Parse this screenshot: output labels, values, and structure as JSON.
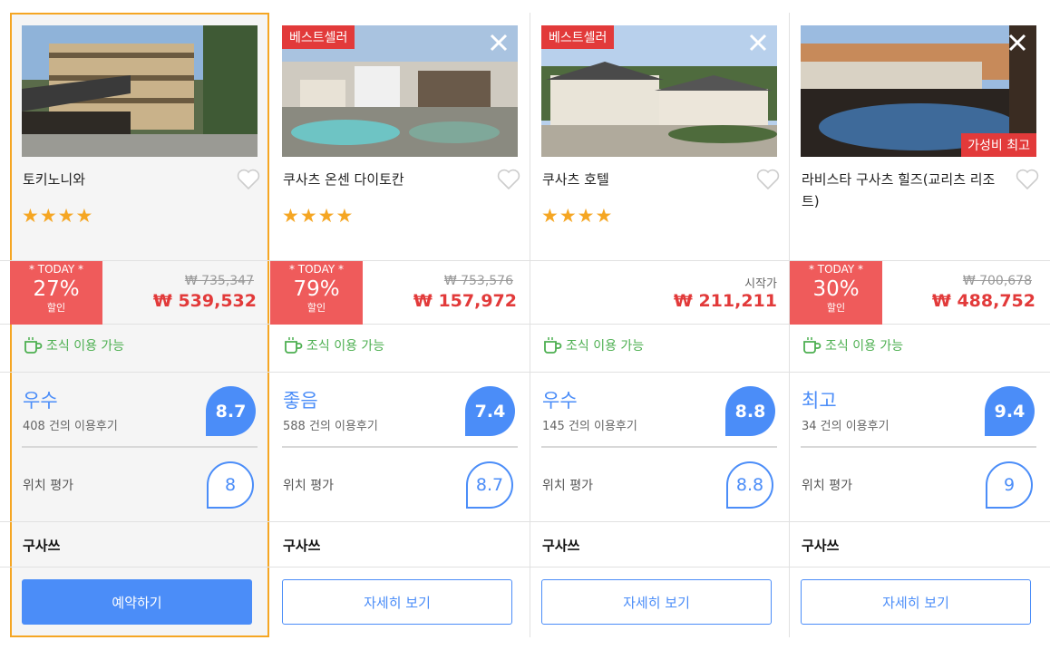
{
  "hotels": [
    {
      "name": "토키노니와",
      "best_badge": "",
      "value_badge": "",
      "stars": "★★★★",
      "today_label": "* TODAY *",
      "discount": "27%",
      "discount_label": "할인",
      "old_price": "₩ 735,347",
      "price": "₩ 539,532",
      "breakfast": "조식 이용 가능",
      "rating_word": "우수",
      "reviews": "408 건의 이용후기",
      "score": "8.7",
      "location_label": "위치 평가",
      "location_score": "8",
      "area": "구사쓰",
      "button": "예약하기"
    },
    {
      "name": "쿠사츠 온센 다이토칸",
      "best_badge": "베스트셀러",
      "value_badge": "",
      "stars": "★★★★",
      "today_label": "* TODAY *",
      "discount": "79%",
      "discount_label": "할인",
      "old_price": "₩ 753,576",
      "price": "₩ 157,972",
      "breakfast": "조식 이용 가능",
      "rating_word": "좋음",
      "reviews": "588 건의 이용후기",
      "score": "7.4",
      "location_label": "위치 평가",
      "location_score": "8.7",
      "area": "구사쓰",
      "button": "자세히 보기"
    },
    {
      "name": "쿠사츠 호텔",
      "best_badge": "베스트셀러",
      "value_badge": "",
      "stars": "★★★★",
      "from_label": "시작가",
      "price": "₩ 211,211",
      "breakfast": "조식 이용 가능",
      "rating_word": "우수",
      "reviews": "145 건의 이용후기",
      "score": "8.8",
      "location_label": "위치 평가",
      "location_score": "8.8",
      "area": "구사쓰",
      "button": "자세히 보기"
    },
    {
      "name": "라비스타 구사츠 힐즈(교리츠 리조트)",
      "best_badge": "",
      "value_badge": "가성비 최고",
      "stars": "",
      "today_label": "* TODAY *",
      "discount": "30%",
      "discount_label": "할인",
      "old_price": "₩ 700,678",
      "price": "₩ 488,752",
      "breakfast": "조식 이용 가능",
      "rating_word": "최고",
      "reviews": "34 건의 이용후기",
      "score": "9.4",
      "location_label": "위치 평가",
      "location_score": "9",
      "area": "구사쓰",
      "button": "자세히 보기"
    }
  ],
  "colors": {
    "accent": "#4b8df8",
    "sale": "#ef5b5b",
    "selected_border": "#f5a623",
    "breakfast": "#4caf50"
  },
  "icons": [
    "close-icon",
    "heart-icon",
    "coffee-cup-icon",
    "star-icon"
  ]
}
